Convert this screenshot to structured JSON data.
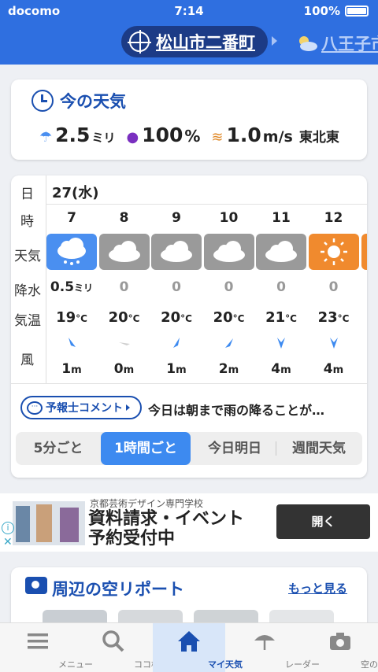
{
  "status": {
    "carrier": "docomo",
    "time": "7:14",
    "battery": "100%"
  },
  "header": {
    "location": "松山市二番町",
    "next_location": "八王子市"
  },
  "now": {
    "title": "今の天気",
    "rain_value": "2.5",
    "rain_unit": "ミリ",
    "humidity_value": "100",
    "humidity_unit": "%",
    "wind_value": "1.0",
    "wind_unit": "m/s",
    "wind_dir": "東北東"
  },
  "hourly": {
    "row_labels": {
      "day": "日",
      "hour": "時",
      "weather": "天気",
      "precip": "降水",
      "temp": "気温",
      "wind": "風"
    },
    "day": "27(水)",
    "temp_unit": "°C",
    "wind_unit": "m",
    "columns": [
      {
        "hour": "7",
        "weather": "rain-cloud-icon",
        "precip": "0.5",
        "precip_unit": "ミリ",
        "temp": "19",
        "wind": "1"
      },
      {
        "hour": "8",
        "weather": "cloud-icon",
        "precip": "0",
        "precip_unit": "",
        "temp": "20",
        "wind": "0"
      },
      {
        "hour": "9",
        "weather": "cloud-icon",
        "precip": "0",
        "precip_unit": "",
        "temp": "20",
        "wind": "1"
      },
      {
        "hour": "10",
        "weather": "cloud-icon",
        "precip": "0",
        "precip_unit": "",
        "temp": "20",
        "wind": "2"
      },
      {
        "hour": "11",
        "weather": "cloud-icon",
        "precip": "0",
        "precip_unit": "",
        "temp": "21",
        "wind": "4"
      },
      {
        "hour": "12",
        "weather": "sun-icon",
        "precip": "0",
        "precip_unit": "",
        "temp": "23",
        "wind": "4"
      }
    ],
    "comment_button": "予報士コメント",
    "comment_text": "今日は朝まで雨の降ることが…",
    "tabs": [
      "5分ごと",
      "1時間ごと",
      "今日明日",
      "週間天気"
    ]
  },
  "ad": {
    "small": "京都芸術デザイン専門学校",
    "headline1": "資料請求・イベント",
    "headline2": "予約受付中",
    "button": "開く",
    "info": "i",
    "close": "✕"
  },
  "sky": {
    "title": "周辺の空リポート",
    "more": "もっと見る"
  },
  "tabbar": {
    "items": [
      "メニュー",
      "ココ検索",
      "マイ天気",
      "レーダー",
      "空の写真"
    ]
  },
  "colors": {
    "brand": "#2f6fe0",
    "accent": "#1a4fb0",
    "rain": "#4a8ff0",
    "sun": "#f08a2e"
  }
}
